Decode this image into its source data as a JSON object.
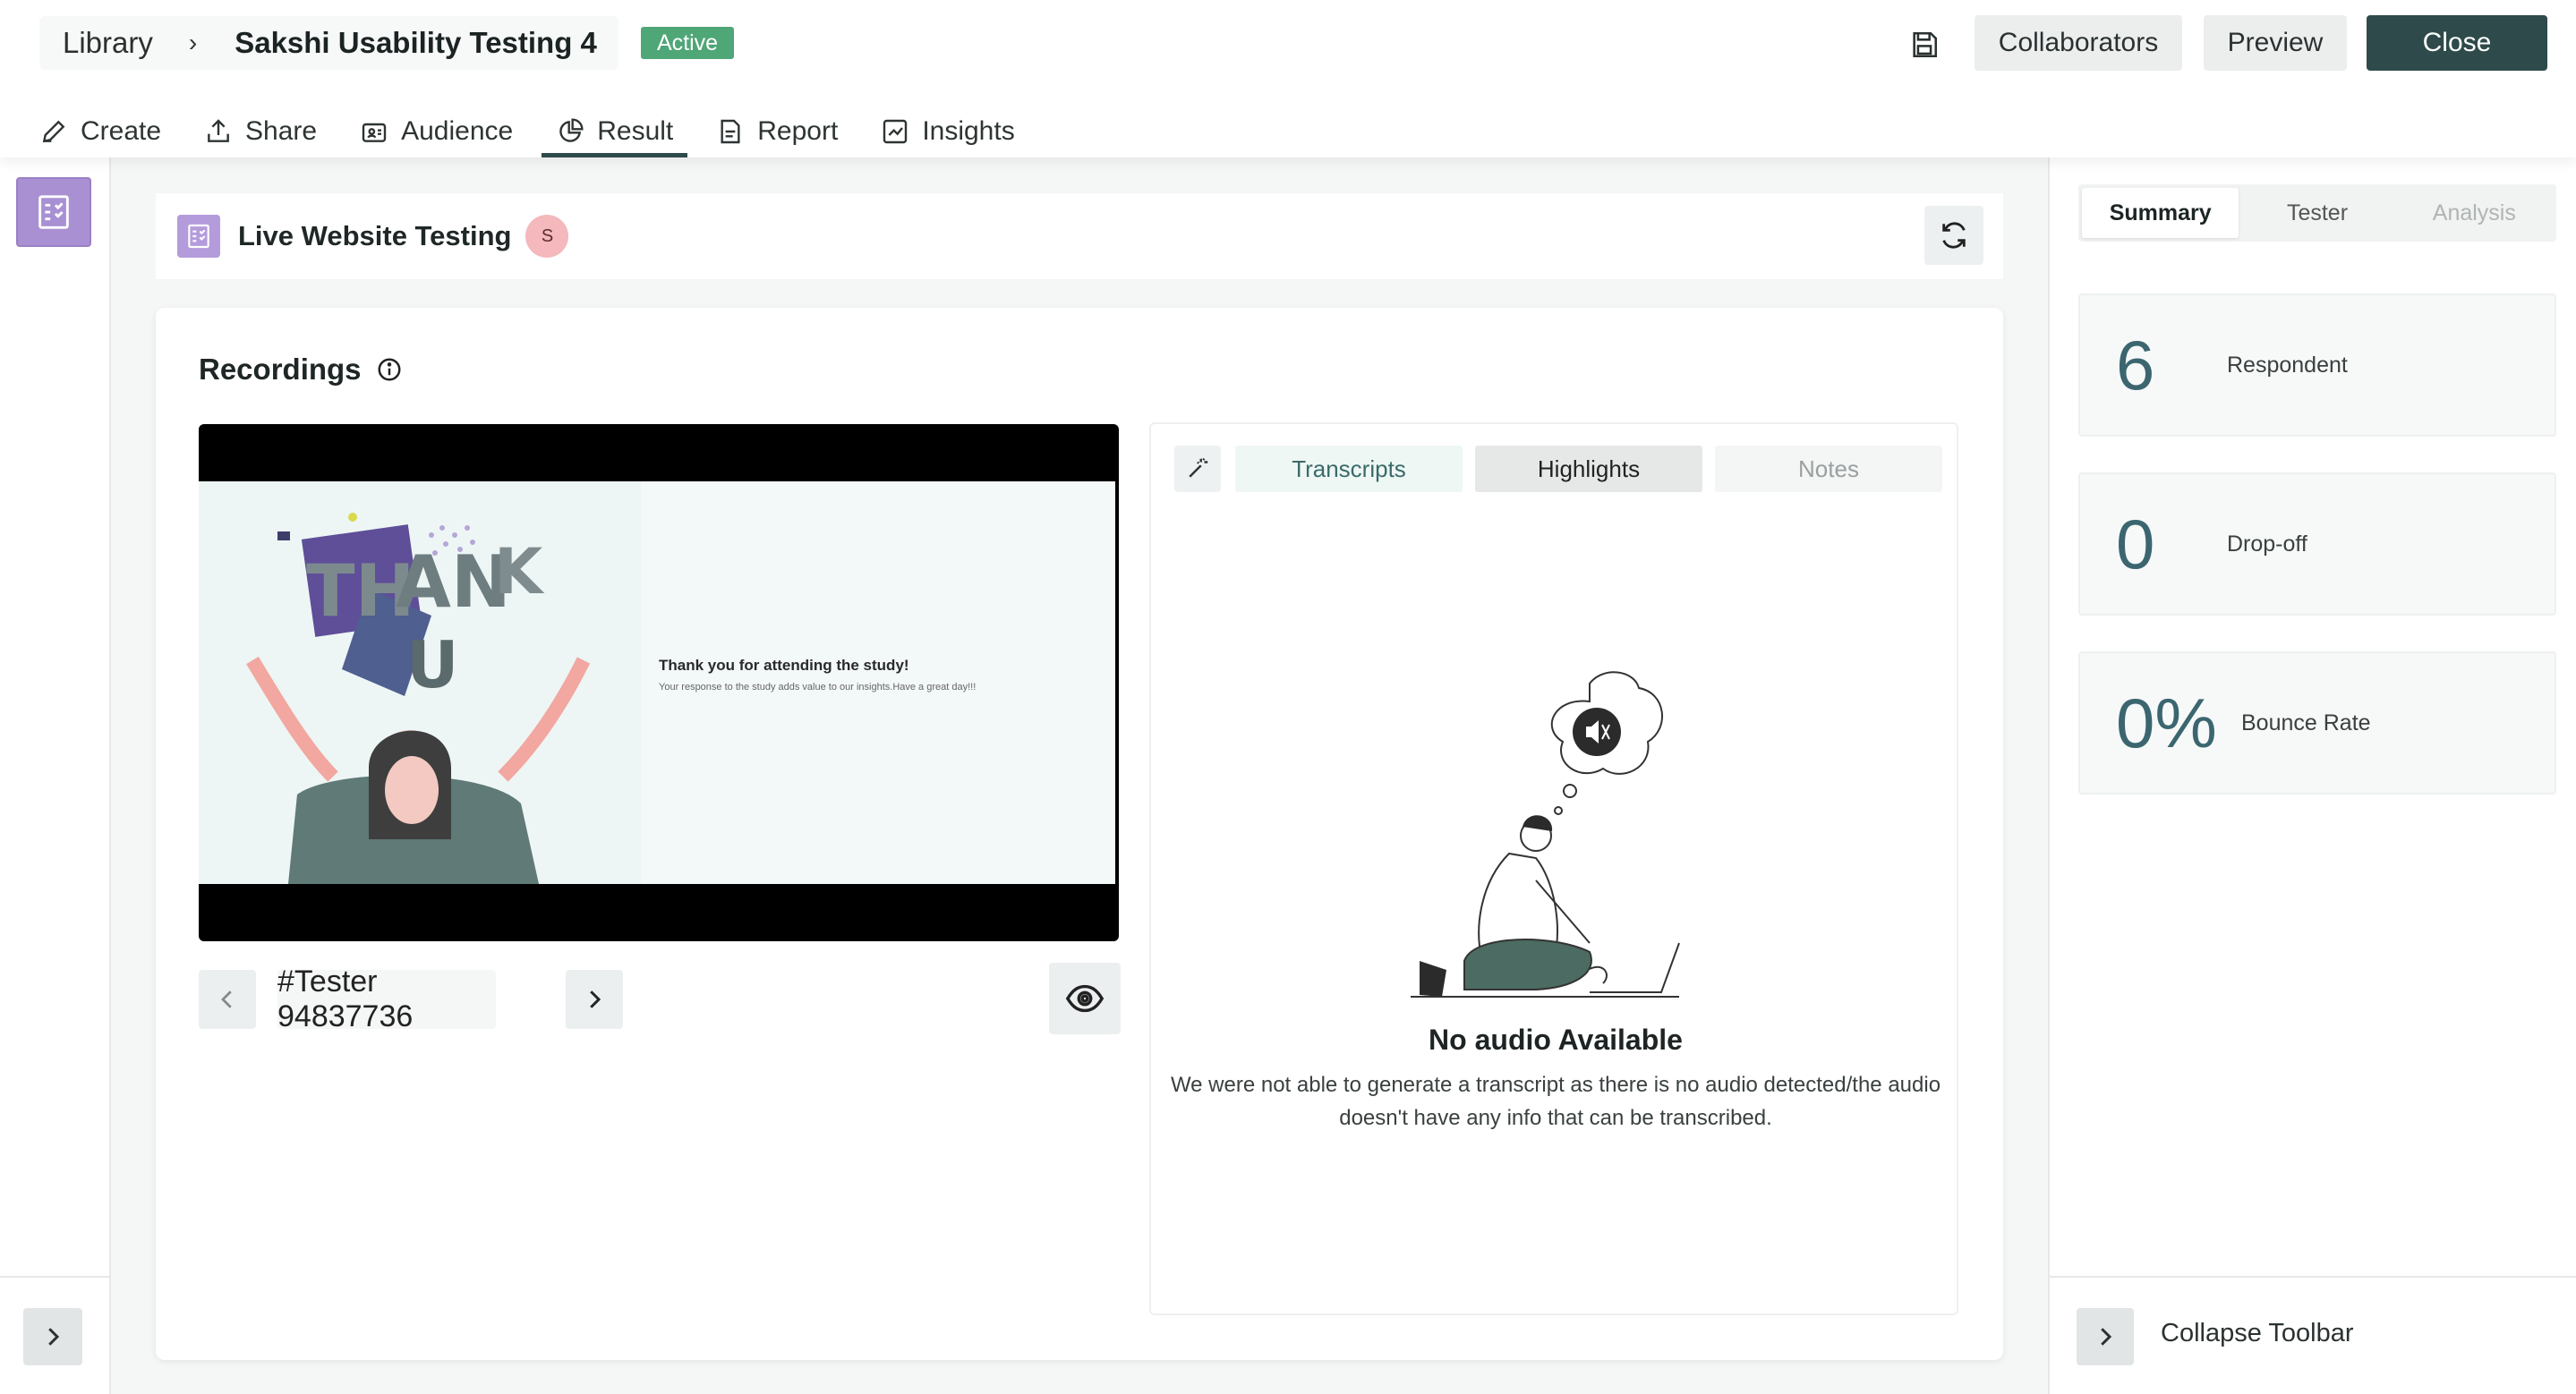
{
  "header": {
    "breadcrumb_library": "Library",
    "breadcrumb_sep": "›",
    "study_title": "Sakshi Usability Testing 4",
    "status_badge": "Active",
    "collaborators_label": "Collaborators",
    "preview_label": "Preview",
    "close_label": "Close"
  },
  "nav": {
    "tabs": [
      {
        "label": "Create",
        "icon": "pencil-icon"
      },
      {
        "label": "Share",
        "icon": "share-icon"
      },
      {
        "label": "Audience",
        "icon": "audience-icon"
      },
      {
        "label": "Result",
        "icon": "pie-chart-icon",
        "active": true
      },
      {
        "label": "Report",
        "icon": "report-icon"
      },
      {
        "label": "Insights",
        "icon": "insights-icon"
      }
    ]
  },
  "test": {
    "name": "Live Website Testing",
    "avatar_initial": "S"
  },
  "recordings": {
    "title": "Recordings",
    "slide_title": "Thank you for attending the study!",
    "slide_subtitle": "Your response to the study adds value to our insights.Have a great day!!!",
    "tester_label": "#Tester 94837736"
  },
  "transcript_panel": {
    "tabs": [
      "Transcripts",
      "Highlights",
      "Notes"
    ],
    "empty_title": "No audio Available",
    "empty_text": "We were not able to generate a transcript as there is no audio detected/the audio doesn't have any info that can be transcribed."
  },
  "sidebar": {
    "tabs": [
      {
        "label": "Summary",
        "state": "active"
      },
      {
        "label": "Tester",
        "state": "normal"
      },
      {
        "label": "Analysis",
        "state": "disabled"
      }
    ],
    "stats": [
      {
        "value": "6",
        "label": "Respondent"
      },
      {
        "value": "0",
        "label": "Drop-off"
      },
      {
        "value": "0%",
        "label": "Bounce Rate"
      }
    ],
    "collapse_label": "Collapse Toolbar"
  },
  "colors": {
    "primary": "#2f4a4a",
    "active_badge": "#4fa677",
    "stat_value": "#3b6670",
    "test_icon": "#b49cdc"
  }
}
